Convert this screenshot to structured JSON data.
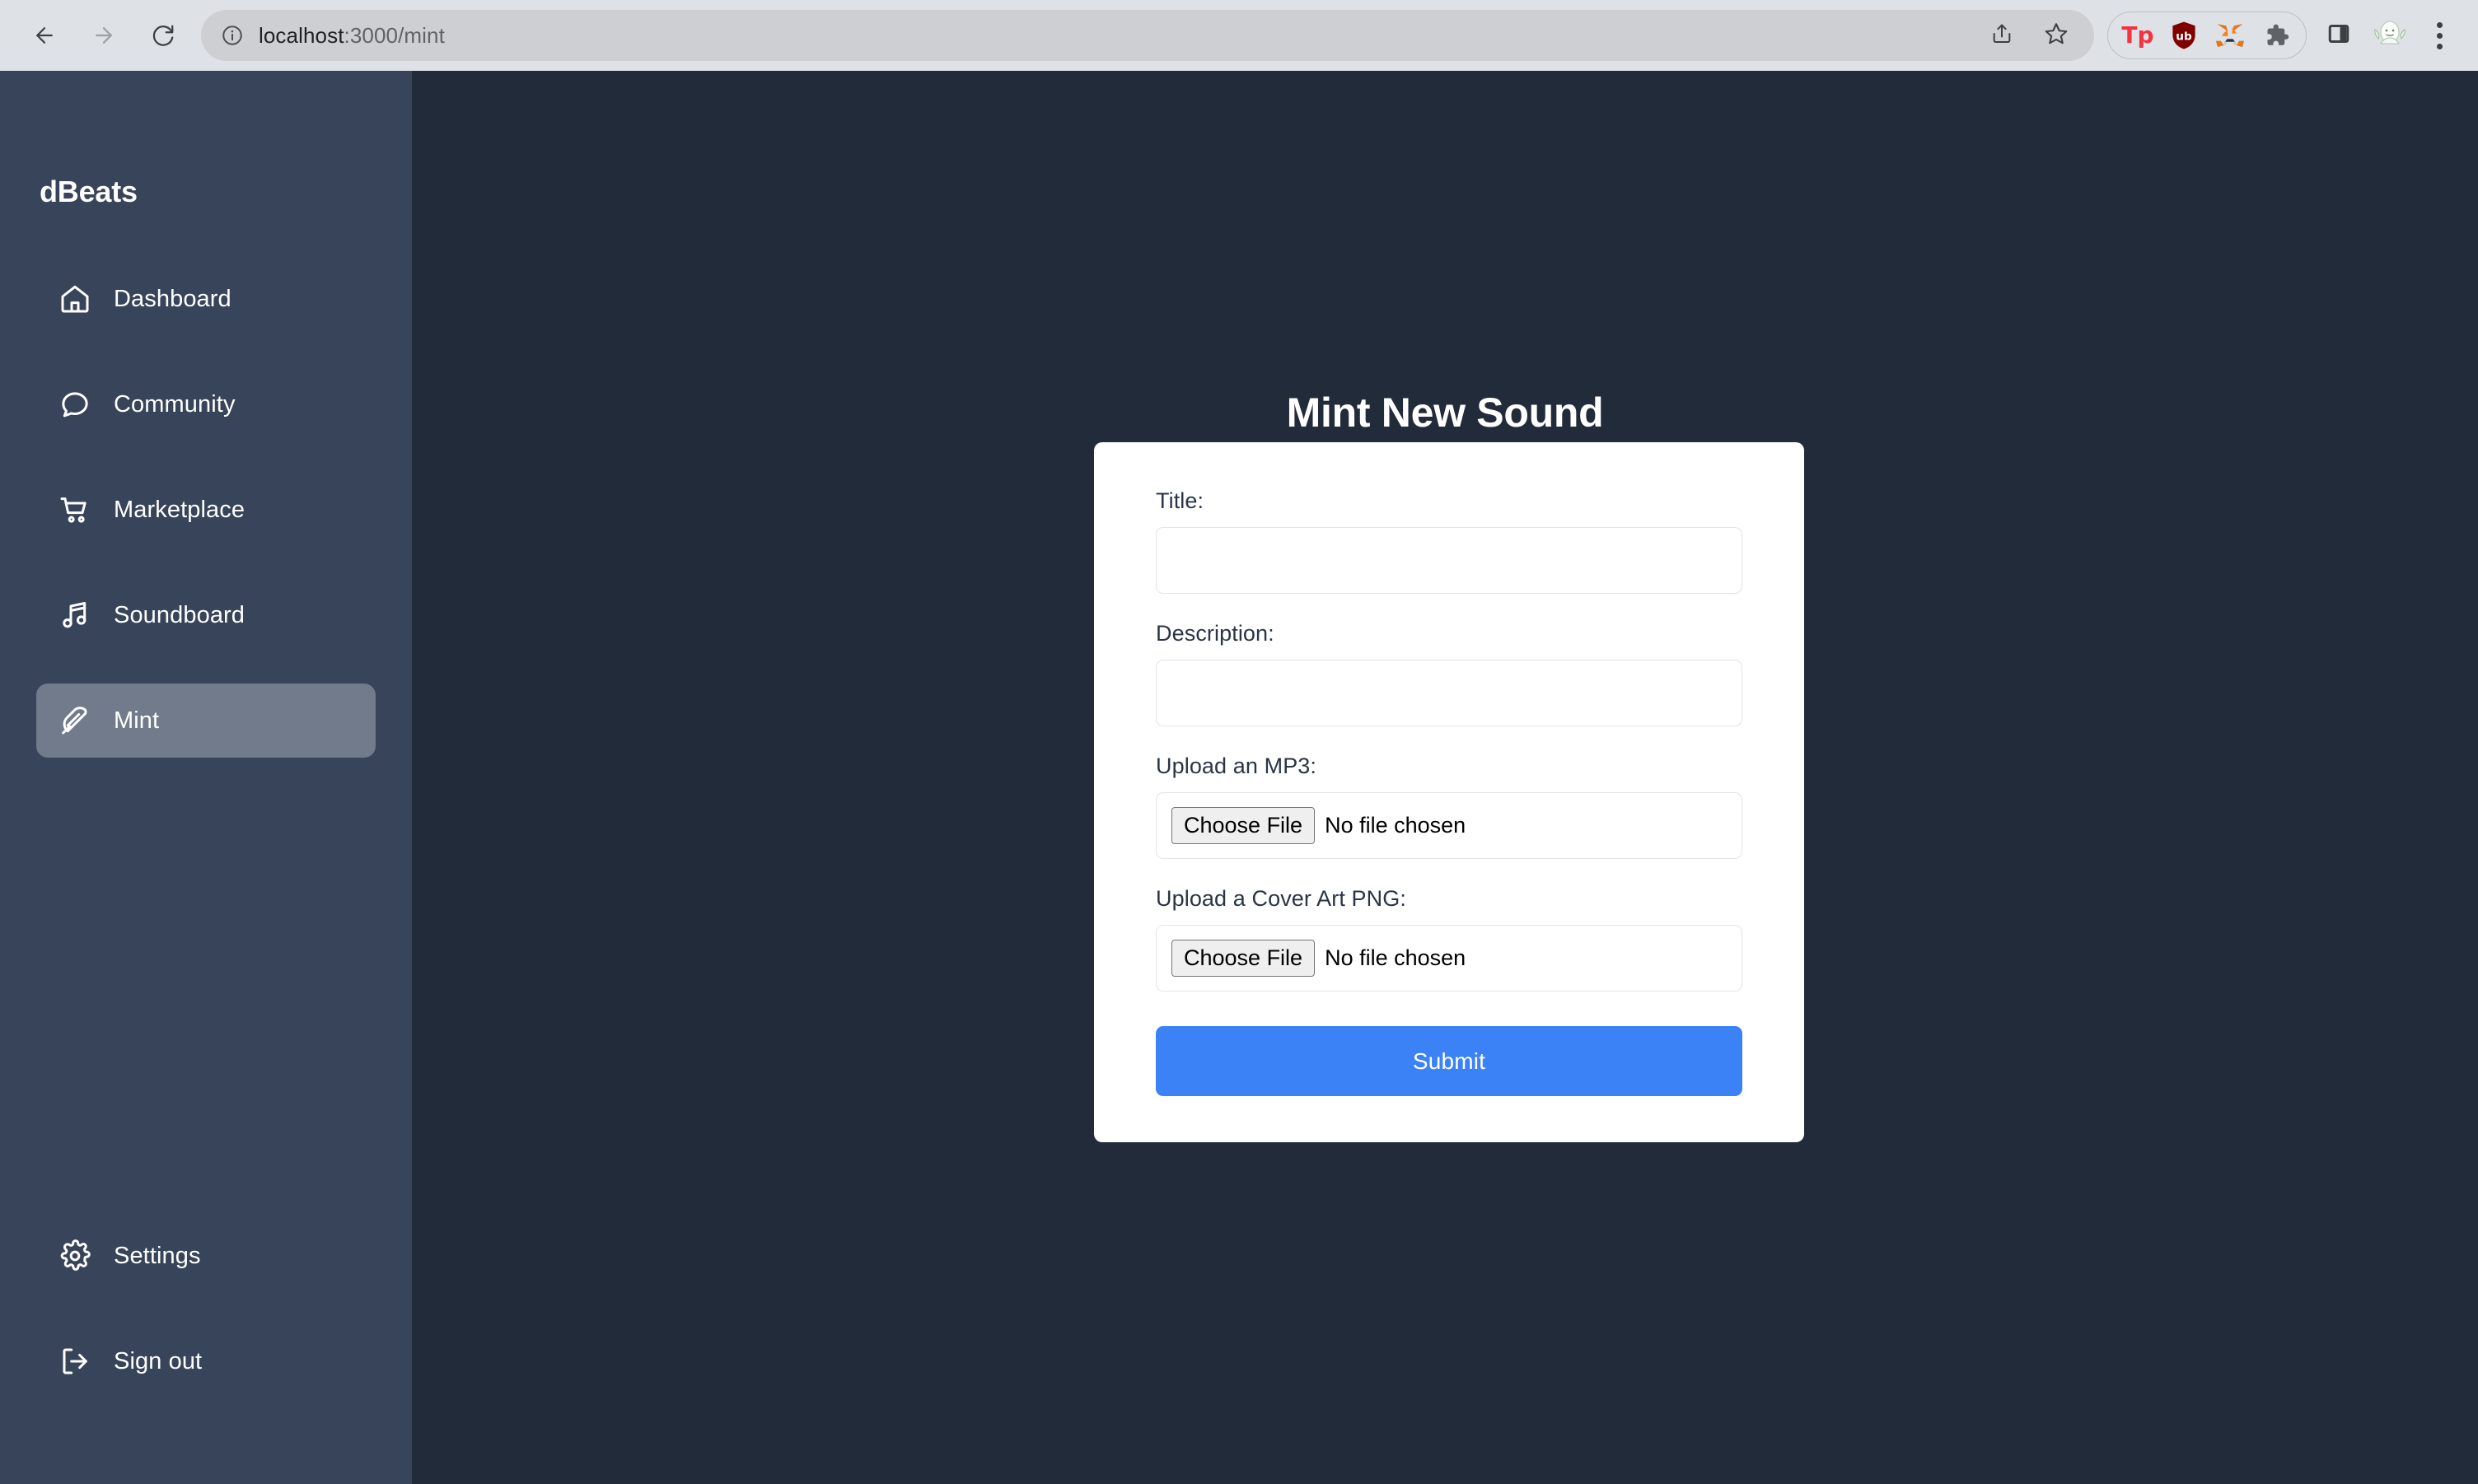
{
  "browser": {
    "back_icon": "back-arrow-icon",
    "forward_icon": "forward-arrow-icon",
    "reload_icon": "reload-icon",
    "site_info_icon": "info-circle-icon",
    "url_host": "localhost",
    "url_path": ":3000/mint",
    "share_icon": "share-icon",
    "bookmark_icon": "star-icon",
    "extensions": [
      {
        "name": "tp-extension-icon",
        "label": "Tp"
      },
      {
        "name": "ublock-origin-icon",
        "label": "ub"
      },
      {
        "name": "metamask-icon",
        "label": ""
      },
      {
        "name": "extensions-puzzle-icon",
        "label": ""
      }
    ],
    "side_panel_icon": "side-panel-icon",
    "avatar_icon": "profile-avatar-icon",
    "menu_icon": "three-dot-menu-icon"
  },
  "sidebar": {
    "brand": "dBeats",
    "items": [
      {
        "label": "Dashboard",
        "icon": "home-icon",
        "active": false
      },
      {
        "label": "Community",
        "icon": "chat-bubble-icon",
        "active": false
      },
      {
        "label": "Marketplace",
        "icon": "cart-icon",
        "active": false
      },
      {
        "label": "Soundboard",
        "icon": "music-note-icon",
        "active": false
      },
      {
        "label": "Mint",
        "icon": "feather-icon",
        "active": true
      }
    ],
    "bottom_items": [
      {
        "label": "Settings",
        "icon": "gear-icon"
      },
      {
        "label": "Sign out",
        "icon": "sign-out-icon"
      }
    ]
  },
  "main": {
    "title": "Mint New Sound",
    "form": {
      "title_label": "Title:",
      "title_value": "",
      "title_placeholder": "",
      "description_label": "Description:",
      "description_value": "",
      "description_placeholder": "",
      "mp3_label": "Upload an MP3:",
      "mp3_button": "Choose File",
      "mp3_status": "No file chosen",
      "cover_label": "Upload a Cover Art PNG:",
      "cover_button": "Choose File",
      "cover_status": "No file chosen",
      "submit_label": "Submit"
    }
  },
  "colors": {
    "sidebar_bg": "#384459",
    "main_bg": "#222b3a",
    "active_item_bg": "#717b8c",
    "card_bg": "#ffffff",
    "accent_blue": "#3b82f6",
    "label_text": "#2b3445",
    "browser_chrome_bg": "#dee1e6",
    "url_bar_bg": "#cdcfd2"
  }
}
